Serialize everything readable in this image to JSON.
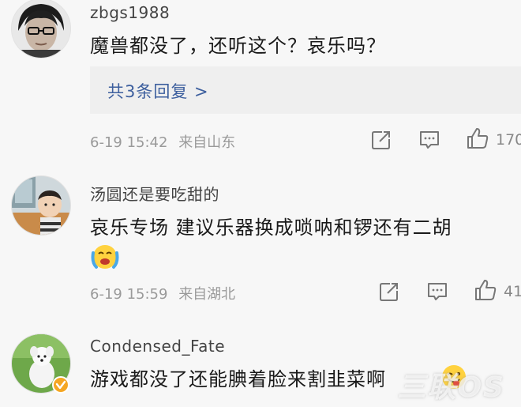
{
  "comments": [
    {
      "username": "zbgs1988",
      "text": "魔兽都没了，还听这个？哀乐吗？",
      "reply_summary": "共3条回复 >",
      "time": "6-19 15:42",
      "source": "来自山东",
      "like_count": "170"
    },
    {
      "username": "汤圆还是要吃甜的",
      "text": "哀乐专场 建议乐器换成唢呐和锣还有二胡",
      "time": "6-19 15:59",
      "source": "来自湖北",
      "like_count": "41"
    },
    {
      "username": "Condensed_Fate",
      "text": "游戏都没了还能腆着脸来割韭菜啊",
      "verified": true
    }
  ],
  "icons": {
    "share": "share-icon",
    "comment": "comment-icon",
    "like": "thumbs-up-icon",
    "verified": "verified-badge-icon",
    "emoji_cry": "crying-emoji-icon",
    "emoji_tongue": "tongue-emoji-icon"
  },
  "colors": {
    "link": "#3d5f9e",
    "meta": "#9a9a9a",
    "verified_badge": "#f5a623"
  }
}
